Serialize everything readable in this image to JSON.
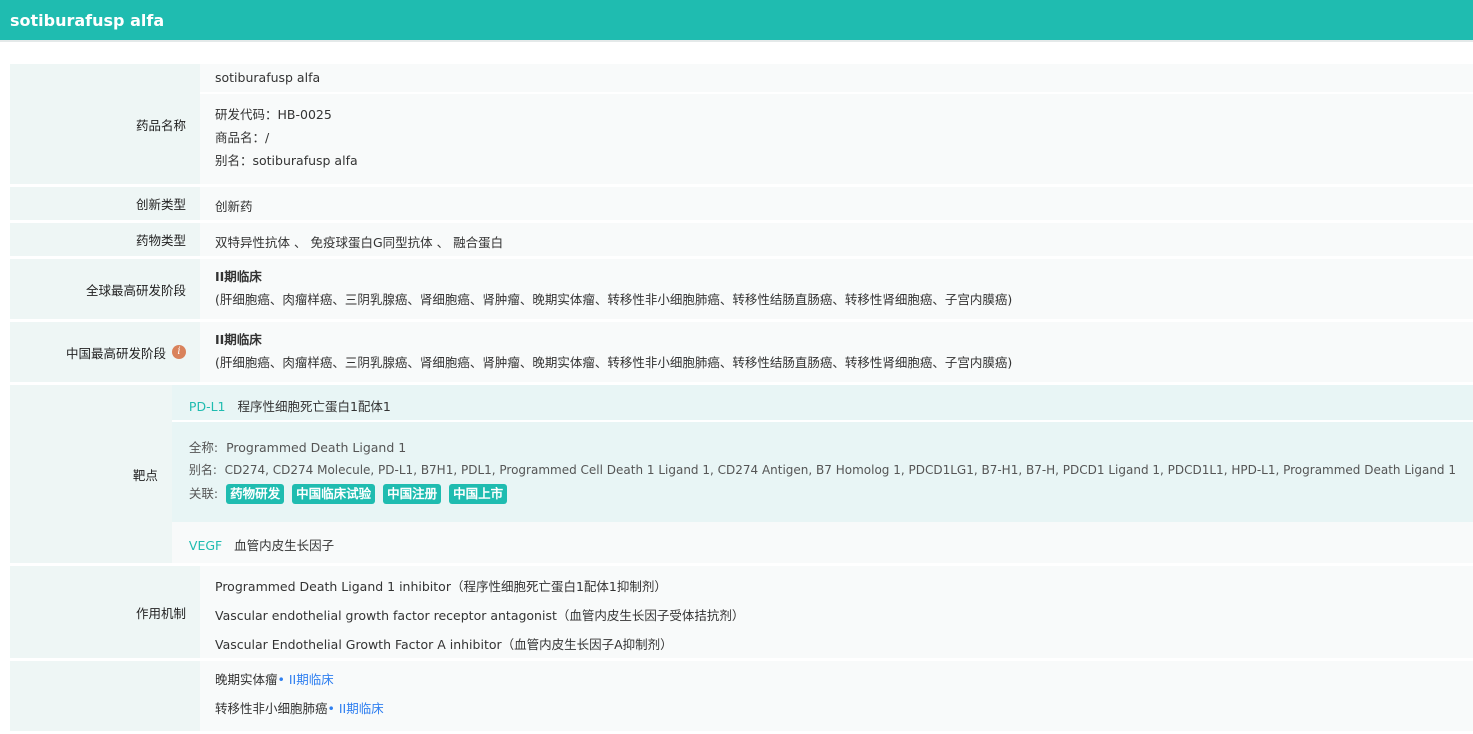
{
  "title": "sotiburafusp alfa",
  "name": {
    "label": "药品名称",
    "value": "sotiburafusp alfa",
    "code": "研发代码：HB-0025",
    "trade": "商品名：/",
    "alias": "别名：sotiburafusp alfa"
  },
  "innovation": {
    "label": "创新类型",
    "value": "创新药"
  },
  "drug_type": {
    "label": "药物类型",
    "value": "双特异性抗体 、 免疫球蛋白G同型抗体 、 融合蛋白"
  },
  "global": {
    "label": "全球最高研发阶段",
    "phase": "II期临床",
    "indications": "(肝细胞癌、肉瘤样癌、三阴乳腺癌、肾细胞癌、肾肿瘤、晚期实体瘤、转移性非小细胞肺癌、转移性结肠直肠癌、转移性肾细胞癌、子宫内膜癌)"
  },
  "china": {
    "label": "中国最高研发阶段",
    "phase": "II期临床",
    "indications": "(肝细胞癌、肉瘤样癌、三阴乳腺癌、肾细胞癌、肾肿瘤、晚期实体瘤、转移性非小细胞肺癌、转移性结肠直肠癌、转移性肾细胞癌、子宫内膜癌)"
  },
  "target": {
    "label": "靶点",
    "t1": {
      "code": "PD-L1",
      "name": "程序性细胞死亡蛋白1配体1",
      "full_label": "全称:",
      "full": "Programmed Death Ligand 1",
      "alias_label": "别名:",
      "alias": "CD274, CD274 Molecule, PD-L1, B7H1, PDL1, Programmed Cell Death 1 Ligand 1, CD274 Antigen, B7 Homolog 1, PDCD1LG1, B7-H1, B7-H, PDCD1 Ligand 1, PDCD1L1, HPD-L1, Programmed Death Ligand 1",
      "rel_label": "关联:",
      "tags": [
        "药物研发",
        "中国临床试验",
        "中国注册",
        "中国上市"
      ]
    },
    "t2": {
      "code": "VEGF",
      "name": "血管内皮生长因子"
    }
  },
  "mechanism": {
    "label": "作用机制",
    "items": [
      "Programmed Death Ligand 1 inhibitor（程序性细胞死亡蛋白1配体1抑制剂）",
      "Vascular endothelial growth factor receptor antagonist（血管内皮生长因子受体拮抗剂）",
      "Vascular Endothelial Growth Factor A inhibitor（血管内皮生长因子A抑制剂）"
    ]
  },
  "indications": [
    {
      "name": "晚期实体瘤",
      "phase": "• II期临床"
    },
    {
      "name": "转移性非小细胞肺癌",
      "phase": "• II期临床"
    }
  ],
  "colors": {
    "accent": "#1fbcb0",
    "link": "#2f7ff0",
    "info": "#d9825b"
  }
}
